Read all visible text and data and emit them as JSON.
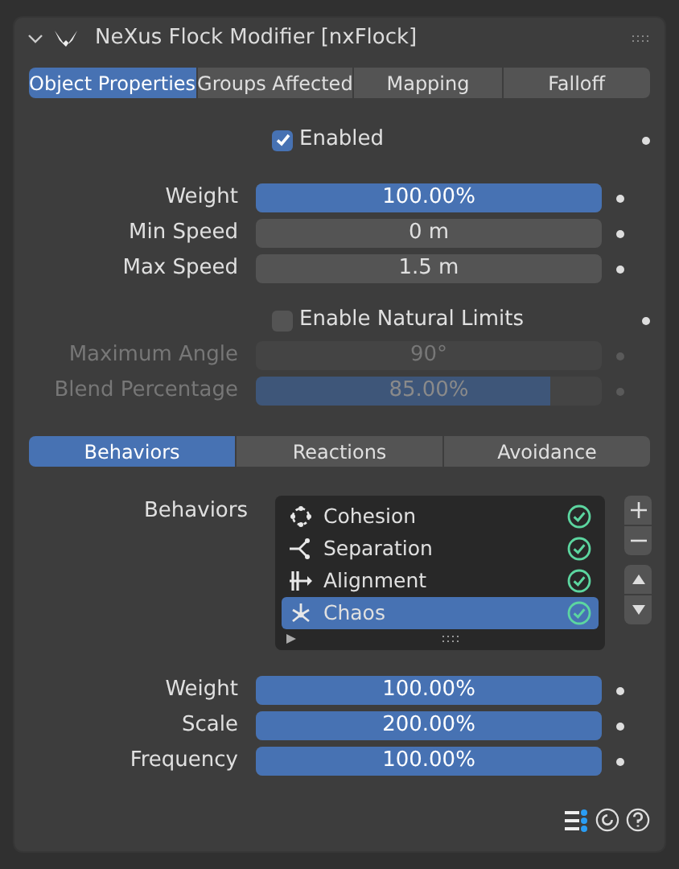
{
  "panel": {
    "title": "NeXus Flock Modifier [nxFlock]",
    "expanded": true
  },
  "tabs": [
    {
      "label": "Object Properties",
      "selected": true
    },
    {
      "label": "Groups Affected",
      "selected": false
    },
    {
      "label": "Mapping",
      "selected": false
    },
    {
      "label": "Falloff",
      "selected": false
    }
  ],
  "enabled": {
    "label": "Enabled",
    "checked": true
  },
  "fields": [
    {
      "kind": "slider",
      "label": "Weight",
      "value": "100.00%",
      "level": 1,
      "disabled": false
    },
    {
      "kind": "number",
      "label": "Min Speed",
      "value": "0 m",
      "disabled": false
    },
    {
      "kind": "number",
      "label": "Max Speed",
      "value": "1.5 m",
      "disabled": false
    }
  ],
  "natural_limits": {
    "label": "Enable Natural Limits",
    "checked": false
  },
  "limit_fields": [
    {
      "kind": "number",
      "label": "Maximum Angle",
      "value": "90°",
      "disabled": true
    },
    {
      "kind": "slider",
      "label": "Blend Percentage",
      "value": "85.00%",
      "level": 0.85,
      "disabled": true
    }
  ],
  "sub_tabs": [
    {
      "label": "Behaviors",
      "selected": true
    },
    {
      "label": "Reactions",
      "selected": false
    },
    {
      "label": "Avoidance",
      "selected": false
    }
  ],
  "behaviors": {
    "label": "Behaviors",
    "items": [
      {
        "name": "Cohesion",
        "selected": false,
        "active": true
      },
      {
        "name": "Separation",
        "selected": false,
        "active": true
      },
      {
        "name": "Alignment",
        "selected": false,
        "active": true
      },
      {
        "name": "Chaos",
        "selected": true,
        "active": true
      }
    ]
  },
  "behavior_fields": [
    {
      "kind": "slider",
      "label": "Weight",
      "value": "100.00%",
      "level": 1,
      "disabled": false
    },
    {
      "kind": "slider",
      "label": "Scale",
      "value": "200.00%",
      "level": 1,
      "disabled": false
    },
    {
      "kind": "slider",
      "label": "Frequency",
      "value": "100.00%",
      "level": 1,
      "disabled": false
    }
  ]
}
